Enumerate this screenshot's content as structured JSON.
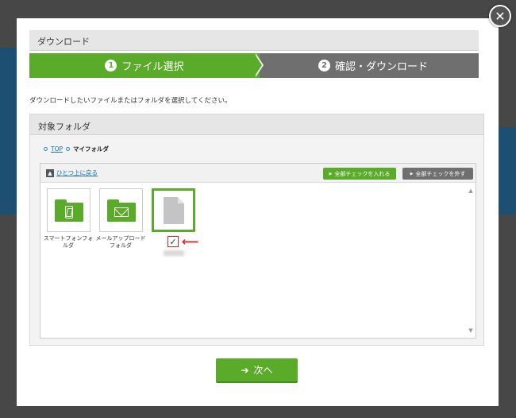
{
  "dialog": {
    "title": "ダウンロード",
    "close_glyph": "✕"
  },
  "steps": [
    {
      "number": "1",
      "label": "ファイル選択",
      "state": "active"
    },
    {
      "number": "2",
      "label": "確認・ダウンロード",
      "state": "inactive"
    }
  ],
  "instruction": "ダウンロードしたいファイルまたはフォルダを選択してください。",
  "folder_panel": {
    "title": "対象フォルダ",
    "breadcrumb": [
      {
        "label": "TOP",
        "link": true
      },
      {
        "label": "マイフォルダ",
        "link": false
      }
    ]
  },
  "browser": {
    "up_link": "ひとつ上に戻る",
    "check_all": "全部チェックを入れる",
    "uncheck_all": "全部チェックを外す",
    "items": [
      {
        "type": "folder",
        "icon": "smartphone-folder-icon",
        "label_line1": "スマートフォンフォ",
        "label_line2": "ルダ",
        "selected": false
      },
      {
        "type": "folder",
        "icon": "mail-folder-icon",
        "label_line1": "メールアップロード",
        "label_line2": "フォルダ",
        "selected": false
      },
      {
        "type": "file",
        "icon": "file-icon",
        "label_line1": "",
        "label_line2": "",
        "selected": true,
        "checked": true
      }
    ]
  },
  "next_button": {
    "label": "次へ",
    "icon": "arrow-right-icon"
  },
  "colors": {
    "accent_green": "#5aab2a",
    "inactive_gray": "#6f6f6f",
    "annotation_red": "#e21b1b"
  }
}
